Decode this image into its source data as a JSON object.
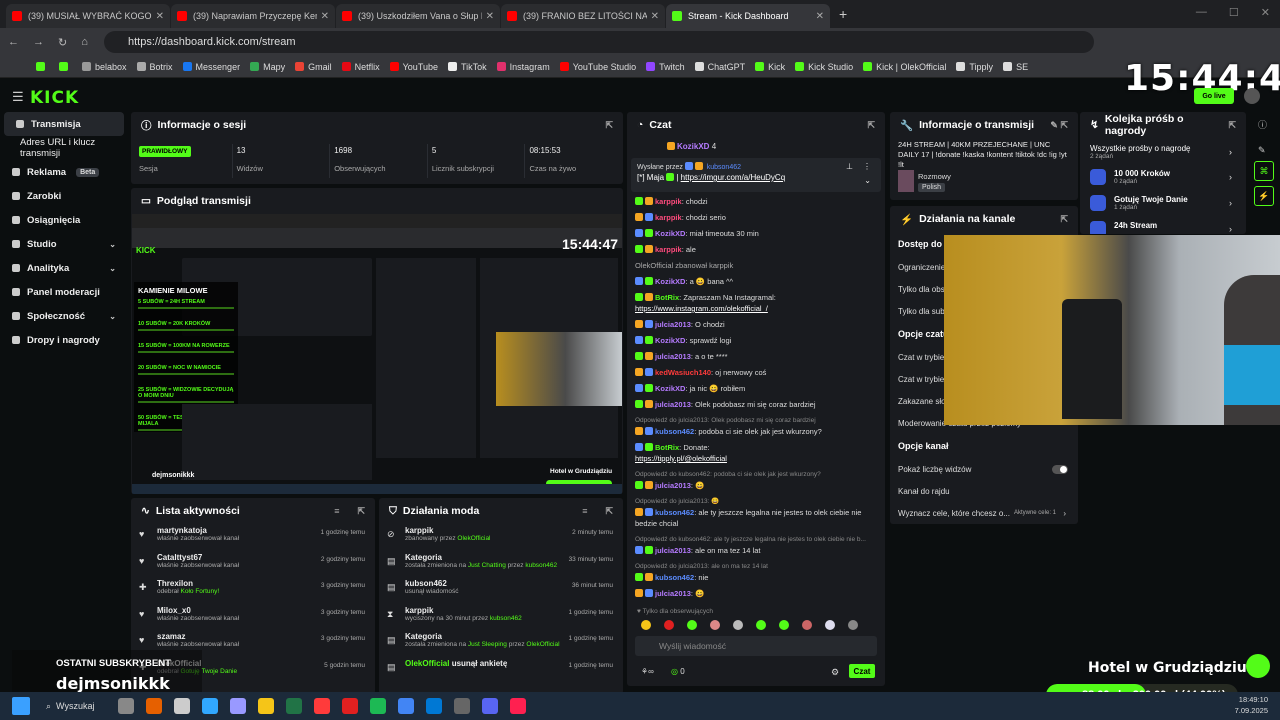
{
  "browser": {
    "tabs": [
      {
        "label": "(39) MUSIAŁ WYBRAĆ KOGO URATU",
        "color": "#ff0000"
      },
      {
        "label": "(39) Naprawiam Przyczepę Kempin",
        "color": "#ff0000"
      },
      {
        "label": "(39) Uszkodziłem Vana o Słup Elek",
        "color": "#ff0000"
      },
      {
        "label": "(39) FRANIO BEZ LITOŚCI NAD NA",
        "color": "#ff0000"
      },
      {
        "label": "Stream - Kick Dashboard",
        "color": "#53fc18",
        "active": true
      }
    ],
    "url": "https://dashboard.kick.com/stream",
    "bookmarks": [
      {
        "label": "",
        "color": "#53fc18"
      },
      {
        "label": "",
        "color": "#53fc18"
      },
      {
        "label": "belabox",
        "color": "#999"
      },
      {
        "label": "Botrix",
        "color": "#aaa"
      },
      {
        "label": "Messenger",
        "color": "#1877f2"
      },
      {
        "label": "Mapy",
        "color": "#34a853"
      },
      {
        "label": "Gmail",
        "color": "#ea4335"
      },
      {
        "label": "Netflix",
        "color": "#e50914"
      },
      {
        "label": "YouTube",
        "color": "#ff0000"
      },
      {
        "label": "TikTok",
        "color": "#eee"
      },
      {
        "label": "Instagram",
        "color": "#e1306c"
      },
      {
        "label": "YouTube Studio",
        "color": "#ff0000"
      },
      {
        "label": "Twitch",
        "color": "#9146ff"
      },
      {
        "label": "ChatGPT",
        "color": "#ddd"
      },
      {
        "label": "Kick",
        "color": "#53fc18"
      },
      {
        "label": "Kick Studio",
        "color": "#53fc18"
      },
      {
        "label": "Kick | OlekOfficial",
        "color": "#53fc18"
      },
      {
        "label": "Tipply",
        "color": "#ddd"
      },
      {
        "label": "SE",
        "color": "#ddd"
      }
    ]
  },
  "header": {
    "logo": "KICK",
    "clock": "15:44:41",
    "go_live": "Go live"
  },
  "sidebar": {
    "items": [
      {
        "label": "Transmisja",
        "active": true
      },
      {
        "label": "Adres URL i klucz transmisji",
        "sub": true
      },
      {
        "label": "Reklama",
        "badge": "Beta"
      },
      {
        "label": "Zarobki"
      },
      {
        "label": "Osiągnięcia"
      },
      {
        "label": "Studio",
        "chevron": true
      },
      {
        "label": "Analityka",
        "chevron": true
      },
      {
        "label": "Panel moderacji"
      },
      {
        "label": "Społeczność",
        "chevron": true
      },
      {
        "label": "Dropy i nagrody"
      }
    ]
  },
  "session": {
    "title": "Informacje o sesji",
    "tag": "PRAWIDŁOWY",
    "stats": [
      {
        "value": "",
        "label": "Sesja"
      },
      {
        "value": "13",
        "label": "Widzów"
      },
      {
        "value": "1698",
        "label": "Obserwujących"
      },
      {
        "value": "5",
        "label": "Licznik subskrypcji"
      },
      {
        "value": "08:15:53",
        "label": "Czas na żywo"
      }
    ]
  },
  "preview": {
    "title": "Podgląd transmisji",
    "inner_clock": "15:44:47",
    "milestones_title": "KAMIENIE MILOWE",
    "milestones": [
      "5 SUBÓW = 24H STREAM",
      "10 SUBÓW = 20K KROKÓW",
      "15 SUBÓW = 100KM NA ROWERZE",
      "20 SUBÓW = NOC W NAMIOCIE",
      "25 SUBÓW = WIDZOWIE DECYDUJĄ O MOIM DNIU",
      "50 SUBÓW = TEST RESTAURACJI Z MIJALA"
    ],
    "inner_sub_name": "dejmsonikkk",
    "inner_hotel": "Hotel w Grudziądziu"
  },
  "activity": {
    "title": "Lista aktywności",
    "rows": [
      {
        "name": "martynkatoja",
        "desc": "właśnie zaobserwował kanał",
        "time": "1 godzinę temu",
        "icon": "♥"
      },
      {
        "name": "Catalttyst67",
        "desc": "właśnie zaobserwował kanał",
        "time": "2 godziny temu",
        "icon": "♥"
      },
      {
        "name": "Threxilon",
        "desc": "odebrał ",
        "desc_hl": "Koło Fortuny!",
        "time": "3 godziny temu",
        "icon": "✚"
      },
      {
        "name": "Milox_x0",
        "desc": "właśnie zaobserwował kanał",
        "time": "3 godziny temu",
        "icon": "♥"
      },
      {
        "name": "szamaz",
        "desc": "właśnie zaobserwował kanał",
        "time": "3 godziny temu",
        "icon": "♥"
      },
      {
        "name": "OlekOfficial",
        "desc": "odebrał ",
        "desc_hl": "Gotuję Twoje Danie",
        "time": "5 godzin temu",
        "icon": "✚"
      }
    ]
  },
  "mod": {
    "title": "Działania moda",
    "rows": [
      {
        "name": "karppik",
        "desc": "zbanowany przez ",
        "hl1": "OlekOfficial",
        "time": "2 minuty temu",
        "icon": "⊘"
      },
      {
        "name": "Kategoria",
        "desc": "została zmieniona na ",
        "hl1": "Just Chatting",
        "mid": " przez ",
        "hl2": "kubson462",
        "time": "33 minuty temu",
        "icon": "▤"
      },
      {
        "name": "kubson462",
        "desc": "usunął wiadomość",
        "time": "36 minut temu",
        "icon": "▤"
      },
      {
        "name": "karppik",
        "desc": "wyciszony na 30 minut przez ",
        "hl1": "kubson462",
        "time": "1 godzinę temu",
        "icon": "⧗"
      },
      {
        "name": "Kategoria",
        "desc": "została zmieniona na ",
        "hl1": "Just Sleeping",
        "mid": " przez ",
        "hl2": "OlekOfficial",
        "time": "1 godzinę temu",
        "icon": "▤"
      },
      {
        "name": "OlekOfficial",
        "desc": " usunął ankietę",
        "time": "1 godzinę temu",
        "icon": "▤",
        "name_green": true
      }
    ]
  },
  "chat": {
    "title": "Czat",
    "top_user": "KozikXD",
    "top_count": "4",
    "pinned_by": "Wysłane przez",
    "pinned_user": "kubson462",
    "pinned_text": "[*] Maja",
    "pinned_link": "https://imgur.com/a/HeuDyCq",
    "messages": [
      {
        "u": "karppik",
        "c": "#ff4b7d",
        "t": ": chodzi"
      },
      {
        "u": "karppik",
        "c": "#ff4b7d",
        "t": ": chodzi serio"
      },
      {
        "u": "KozikXD",
        "c": "#b57bff",
        "t": ": miał timeouta 30 min"
      },
      {
        "u": "karppik",
        "c": "#ff4b7d",
        "t": ": ale"
      },
      {
        "sys": "OlekOfficial zbanował karppik"
      },
      {
        "u": "KozikXD",
        "c": "#b57bff",
        "t": ": a 😀 bana ^^"
      },
      {
        "u": "BotRix",
        "c": "#53fc18",
        "t": ": Zapraszam Na Instagramal:",
        "link": "https://www.instagram.com/olekofficial_/"
      },
      {
        "u": "julcia2013",
        "c": "#b57bff",
        "t": ": O chodzi"
      },
      {
        "u": "KozikXD",
        "c": "#b57bff",
        "t": ": sprawdź logi"
      },
      {
        "u": "julcia2013",
        "c": "#b57bff",
        "t": ": a o te ****"
      },
      {
        "u": "kedWasiuch140",
        "c": "#ff3b3b",
        "t": ": oj nerwowy coś"
      },
      {
        "u": "KozikXD",
        "c": "#b57bff",
        "t": ": ja nic 😀 robiłem"
      },
      {
        "u": "julcia2013",
        "c": "#b57bff",
        "t": ": Olek podobasz mi się coraz bardziej"
      },
      {
        "rep": "Odpowiedź do julcia2013: Olek podobasz mi się coraz bardziej",
        "u": "kubson462",
        "c": "#5b8cff",
        "t": ": podoba ci sie olek jak jest wkurzony?"
      },
      {
        "u": "BotRix",
        "c": "#53fc18",
        "t": ": Donate: ",
        "link": "https://tipply.pl/@olekofficial"
      },
      {
        "rep": "Odpowiedź do kubson462: podoba ci sie olek jak jest wkurzony?",
        "u": "julcia2013",
        "c": "#b57bff",
        "t": ": 😀"
      },
      {
        "rep": "Odpowiedź do julcia2013: 😀",
        "u": "kubson462",
        "c": "#5b8cff",
        "t": ": ale ty jeszcze legalna nie jestes to olek ciebie nie bedzie chcial"
      },
      {
        "rep": "Odpowiedź do kubson462: ale ty jeszcze legalna nie jestes to olek ciebie nie b...",
        "u": "julcia2013",
        "c": "#b57bff",
        "t": ": ale on ma tez 14 lat"
      },
      {
        "rep": "Odpowiedź do julcia2013: ale on ma tez 14 lat",
        "u": "kubson462",
        "c": "#5b8cff",
        "t": ": nie"
      },
      {
        "u": "julcia2013",
        "c": "#b57bff",
        "t": ": 😀"
      },
      {
        "u": "BotRix",
        "c": "#53fc18",
        "t": ": Zapraszam Na Instagramal:",
        "link": "https://www.instagram.com/olekofficial_/"
      }
    ],
    "followers_only": "Tylko dla obserwujących",
    "input_placeholder": "Wyślij wiadomość",
    "send": "Czat",
    "counter_a": "0",
    "counter_b": "0"
  },
  "tinfo": {
    "title": "Informacje o transmisji",
    "stream_title": "24H STREAM | 40KM PRZEJECHANE | UNC DAILY 17 | !donate !kaska !kontent !tiktok !dc !ig !yt !lt",
    "category": "Rozmowy",
    "language": "Polish"
  },
  "actions": {
    "title": "Działania na kanale",
    "rows": [
      {
        "kind": "sect",
        "label": "Dostęp do czatu"
      },
      {
        "kind": "row",
        "label": "Ograniczenie"
      },
      {
        "kind": "row",
        "label": "Tylko dla obserwujących"
      },
      {
        "kind": "row",
        "label": "Tylko dla subskrybentów"
      },
      {
        "kind": "sect",
        "label": "Opcje czatu"
      },
      {
        "kind": "row",
        "label": "Czat w trybie"
      },
      {
        "kind": "row",
        "label": "Czat w trybie"
      },
      {
        "kind": "row",
        "label": "Zakazane słowa"
      },
      {
        "kind": "row",
        "label": "Moderowanie czatu przez poziomy"
      },
      {
        "kind": "sect",
        "label": "Opcje kanał"
      },
      {
        "kind": "toggle",
        "label": "Pokaż liczbę widzów"
      },
      {
        "kind": "row",
        "label": "Kanał do rajdu"
      },
      {
        "kind": "row",
        "label": "Wyznacz cele, które chcesz o...",
        "extra": "Aktywne cele: 1"
      }
    ]
  },
  "queue": {
    "title": "Kolejka próśb o nagrody",
    "all_label": "Wszystkie prośby o nagrodę",
    "all_count": "2 żądań",
    "items": [
      {
        "name": "10 000 Kroków",
        "sub": "0 żądań"
      },
      {
        "name": "Gotuję Twoje Danie",
        "sub": "1 żądań"
      },
      {
        "name": "24h Stream",
        "sub": ""
      }
    ]
  },
  "overlay": {
    "last_sub_label": "OSTATNI SUBSKRYBENT",
    "last_sub_name": "dejmsonikkk",
    "hotel": "Hotel w Grudziądziu",
    "goal_text": "88,00 zł z 200,00 zł (44,00%)",
    "goal_fraction": 0.44
  },
  "taskbar": {
    "search": "Wyszukaj",
    "time": "18:49:10",
    "date": "7.09.2025",
    "icon_colors": [
      "#888",
      "#e66000",
      "#ccc",
      "#31a8ff",
      "#9999ff",
      "#f5c518",
      "#217346",
      "#ff3b3b",
      "#e02020",
      "#1db954",
      "#4285f4",
      "#0078d4",
      "#666",
      "#5865f2",
      "#ff2050"
    ]
  }
}
